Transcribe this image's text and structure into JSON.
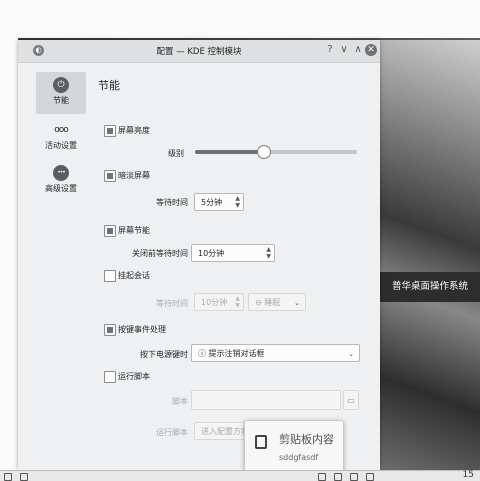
{
  "desktop": {
    "brand_text": "普华桌面操作系统"
  },
  "window": {
    "title": "配置 — KDE 控制模块",
    "help_glyph": "?",
    "minimize_glyph": "∨",
    "maximize_glyph": "∧",
    "close_glyph": "✕"
  },
  "sidebar": {
    "items": [
      {
        "label": "节能",
        "icon": "power-icon",
        "glyph": "⏻",
        "active": true
      },
      {
        "label": "活动设置",
        "icon": "activities-icon",
        "glyph": "ooo",
        "active": false
      },
      {
        "label": "高级设置",
        "icon": "more-icon",
        "glyph": "•••",
        "active": false
      }
    ]
  },
  "page": {
    "title": "节能",
    "screen_brightness": {
      "label": "屏幕亮度",
      "checked": true,
      "level_label": "级别",
      "level_fraction": 0.42
    },
    "dim_screen": {
      "label": "暗淡屏幕",
      "checked": true,
      "wait_label": "等待时间",
      "wait_value": "5分钟"
    },
    "screen_saving": {
      "label": "屏幕节能",
      "checked": true,
      "wait_label": "关闭前等待时间",
      "wait_value": "10分钟"
    },
    "suspend": {
      "label": "挂起会话",
      "checked": false,
      "wait_label": "等待时间",
      "wait_value": "10分钟",
      "mode_value": "睡眠"
    },
    "button_events": {
      "label": "按键事件处理",
      "checked": true,
      "power_label": "按下电源键时",
      "power_value": "提示注销对话框"
    },
    "run_script": {
      "label": "运行脚本",
      "checked": false,
      "script_label": "脚本",
      "script_value": "",
      "when_label": "运行脚本",
      "when_value": "进入配置方案"
    }
  },
  "clipboard_popup": {
    "title": "剪贴板内容",
    "text": "sddgfasdf"
  },
  "taskbar": {
    "clock": "15"
  }
}
